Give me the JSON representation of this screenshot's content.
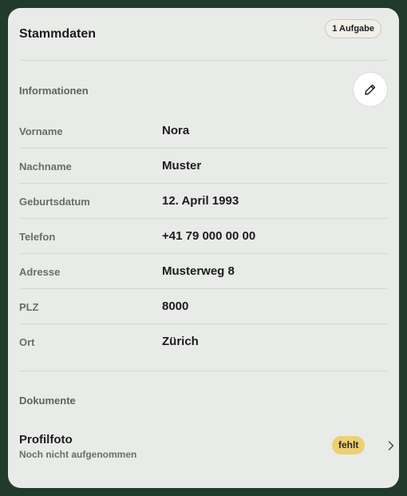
{
  "card": {
    "title": "Stammdaten",
    "task_badge": "1 Aufgabe"
  },
  "informationen": {
    "label": "Informationen",
    "edit_icon": "pencil-icon",
    "rows": [
      {
        "label": "Vorname",
        "value": "Nora"
      },
      {
        "label": "Nachname",
        "value": "Muster"
      },
      {
        "label": "Geburtsdatum",
        "value": "12. April 1993"
      },
      {
        "label": "Telefon",
        "value": "+41 79 000 00 00"
      },
      {
        "label": "Adresse",
        "value": "Musterweg 8"
      },
      {
        "label": "PLZ",
        "value": "8000"
      },
      {
        "label": "Ort",
        "value": "Zürich"
      }
    ]
  },
  "dokumente": {
    "label": "Dokumente",
    "items": [
      {
        "title": "Profilfoto",
        "subtitle": "Noch nicht aufgenommen",
        "status": "fehlt",
        "icon": "chevron-right-icon"
      }
    ]
  },
  "colors": {
    "background": "#213a2c",
    "card": "#e9ebe9",
    "status_missing": "#ecd071"
  }
}
